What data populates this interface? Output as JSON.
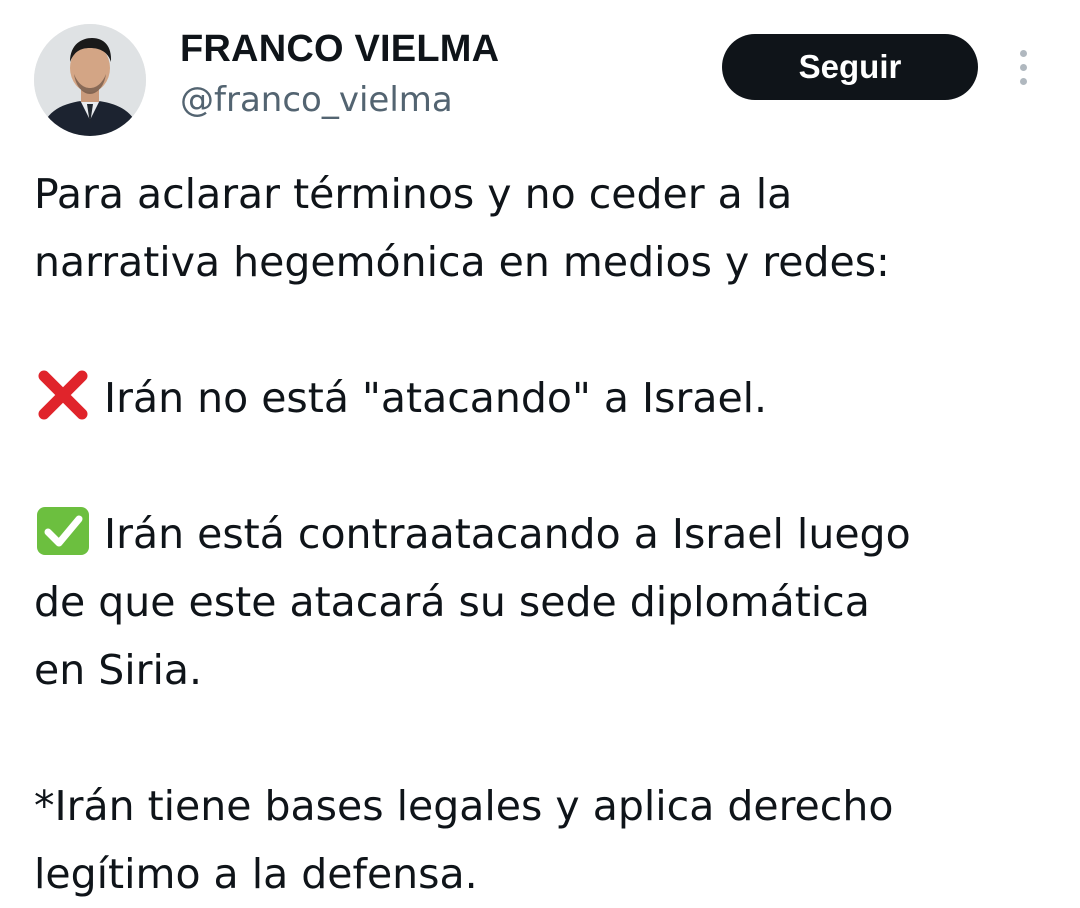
{
  "author": {
    "display_name": "FRANCO VIELMA",
    "handle": "@franco_vielma",
    "avatar_icon": "profile-photo"
  },
  "actions": {
    "follow_label": "Seguir",
    "more_icon": "more-vertical-icon"
  },
  "tweet": {
    "paragraph_1": {
      "line_1": "Para aclarar términos y no ceder a la",
      "line_2": "narrativa hegemónica en medios y redes:"
    },
    "paragraph_2": {
      "icon": "cross-mark-icon",
      "text": "Irán no está \"atacando\" a Israel."
    },
    "paragraph_3": {
      "icon": "check-mark-button-icon",
      "line_1": "Irán está contraatacando a Israel luego",
      "line_2": "de que este atacará su sede diplomática",
      "line_3": "en Siria."
    },
    "paragraph_4": {
      "line_1": "*Irán tiene bases legales y aplica derecho",
      "line_2": "legítimo a la defensa."
    }
  },
  "colors": {
    "text": "#0f1419",
    "secondary_text": "#536471",
    "button_bg": "#0f1419",
    "button_text": "#ffffff",
    "cross_red": "#e0242b",
    "check_green": "#6cbf3f"
  }
}
